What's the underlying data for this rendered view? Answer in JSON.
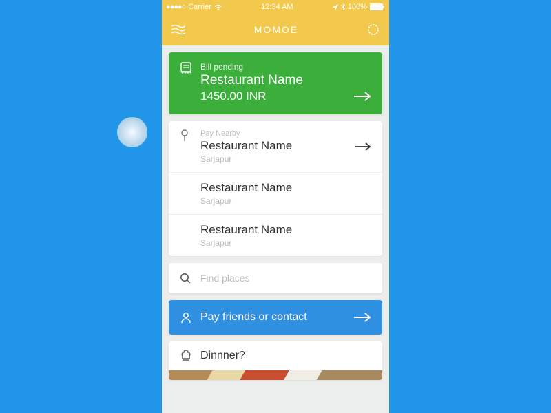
{
  "statusbar": {
    "carrier": "Carrier",
    "time": "12:34 AM",
    "battery": "100%"
  },
  "nav": {
    "title": "MOMOE"
  },
  "bill": {
    "label": "Bill pending",
    "name": "Restaurant Name",
    "amount": "1450.00 INR"
  },
  "nearby": {
    "label": "Pay Nearby",
    "items": [
      {
        "name": "Restaurant Name",
        "location": "Sarjapur"
      },
      {
        "name": "Restaurant Name",
        "location": "Sarjapur"
      },
      {
        "name": "Restaurant Name",
        "location": "Sarjapur"
      }
    ]
  },
  "search": {
    "placeholder": "Find places"
  },
  "payfriends": {
    "label": "Pay friends or contact"
  },
  "dinner": {
    "label": "Dinnner?"
  }
}
